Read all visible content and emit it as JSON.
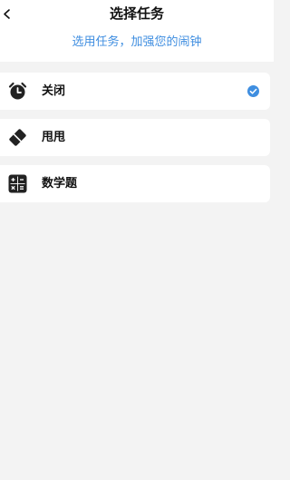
{
  "header": {
    "back_icon": "chevron-left-icon",
    "title": "选择任务",
    "subtitle": "选用任务，加强您的闹钟"
  },
  "tasks": [
    {
      "label": "关闭",
      "icon": "alarm-clock-icon",
      "selected": true
    },
    {
      "label": "甩甩",
      "icon": "shake-phone-icon",
      "selected": false
    },
    {
      "label": "数学题",
      "icon": "calculator-icon",
      "selected": false
    }
  ],
  "colors": {
    "accent": "#3f8ee0",
    "background": "#f3f3f3",
    "card": "#ffffff",
    "text": "#111111"
  }
}
